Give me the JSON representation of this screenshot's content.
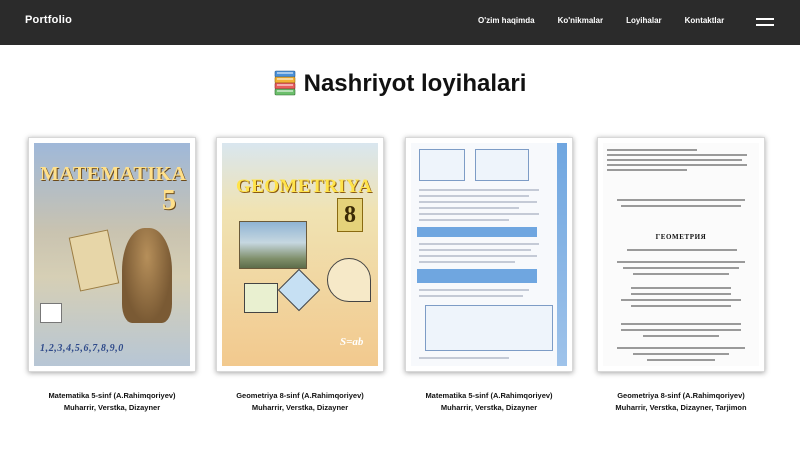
{
  "navbar": {
    "brand": "Portfolio",
    "links": [
      "O'zim haqimda",
      "Ko'nikmalar",
      "Loyihalar",
      "Kontaktlar"
    ]
  },
  "section": {
    "title": "Nashriyot loyihalari"
  },
  "covers": [
    {
      "title": "MATEMATIKA",
      "number": "5",
      "digits": "1,2,3,4,5,6,7,8,9,0"
    },
    {
      "title": "GEOMETRIYA",
      "number": "8",
      "formula": "S=ab"
    },
    {},
    {
      "title": "ГЕОМЕТРИЯ"
    }
  ],
  "projects": [
    {
      "title": "Matematika 5-sinf (A.Rahimqoriyev)",
      "roles": "Muharrir, Verstka, Dizayner"
    },
    {
      "title": "Geometriya 8-sinf (A.Rahimqoriyev)",
      "roles": "Muharrir, Verstka, Dizayner"
    },
    {
      "title": "Matematika 5-sinf (A.Rahimqoriyev)",
      "roles": "Muharrir, Verstka, Dizayner"
    },
    {
      "title": "Geometriya 8-sinf (A.Rahimqoriyev)",
      "roles": "Muharrir, Verstka, Dizayner, Tarjimon"
    }
  ],
  "colors": {
    "navbar_bg": "#2b2b2b",
    "page_bg": "#ffffff",
    "text": "#111111"
  }
}
